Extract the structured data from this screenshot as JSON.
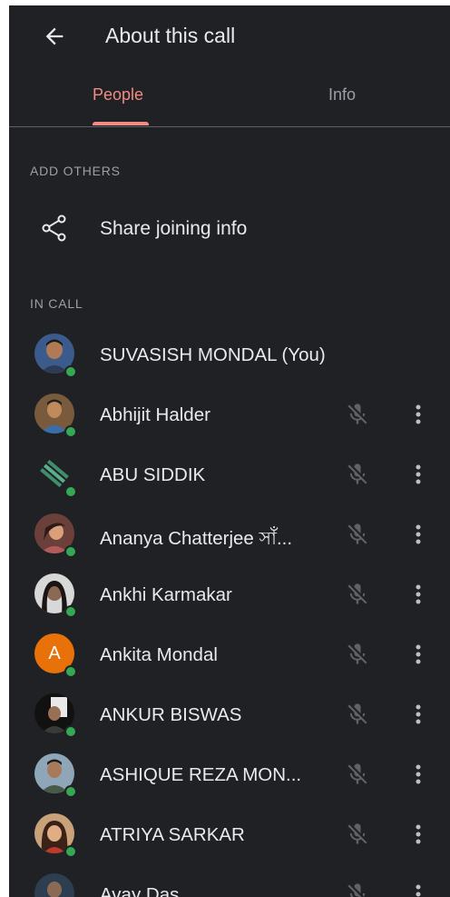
{
  "header": {
    "title": "About this call"
  },
  "tabs": [
    {
      "label": "People"
    },
    {
      "label": "Info"
    }
  ],
  "add_others": {
    "section_label": "ADD OTHERS",
    "share_label": "Share joining info"
  },
  "in_call": {
    "section_label": "IN CALL",
    "participants": [
      {
        "name": "SUVASISH MONDAL (You)"
      },
      {
        "name": "Abhijit Halder"
      },
      {
        "name": "ABU SIDDIK"
      },
      {
        "name": "Ananya Chatterjee সাঁ..."
      },
      {
        "name": "Ankhi Karmakar"
      },
      {
        "name": "Ankita Mondal",
        "initial": "A"
      },
      {
        "name": "ANKUR BISWAS"
      },
      {
        "name": "ASHIQUE REZA MON..."
      },
      {
        "name": "ATRIYA SARKAR"
      },
      {
        "name": "Avay Das"
      }
    ]
  },
  "colors": {
    "background": "#202124",
    "accent": "#f28b82",
    "presence": "#34a853",
    "avatar_orange": "#e8710a"
  }
}
